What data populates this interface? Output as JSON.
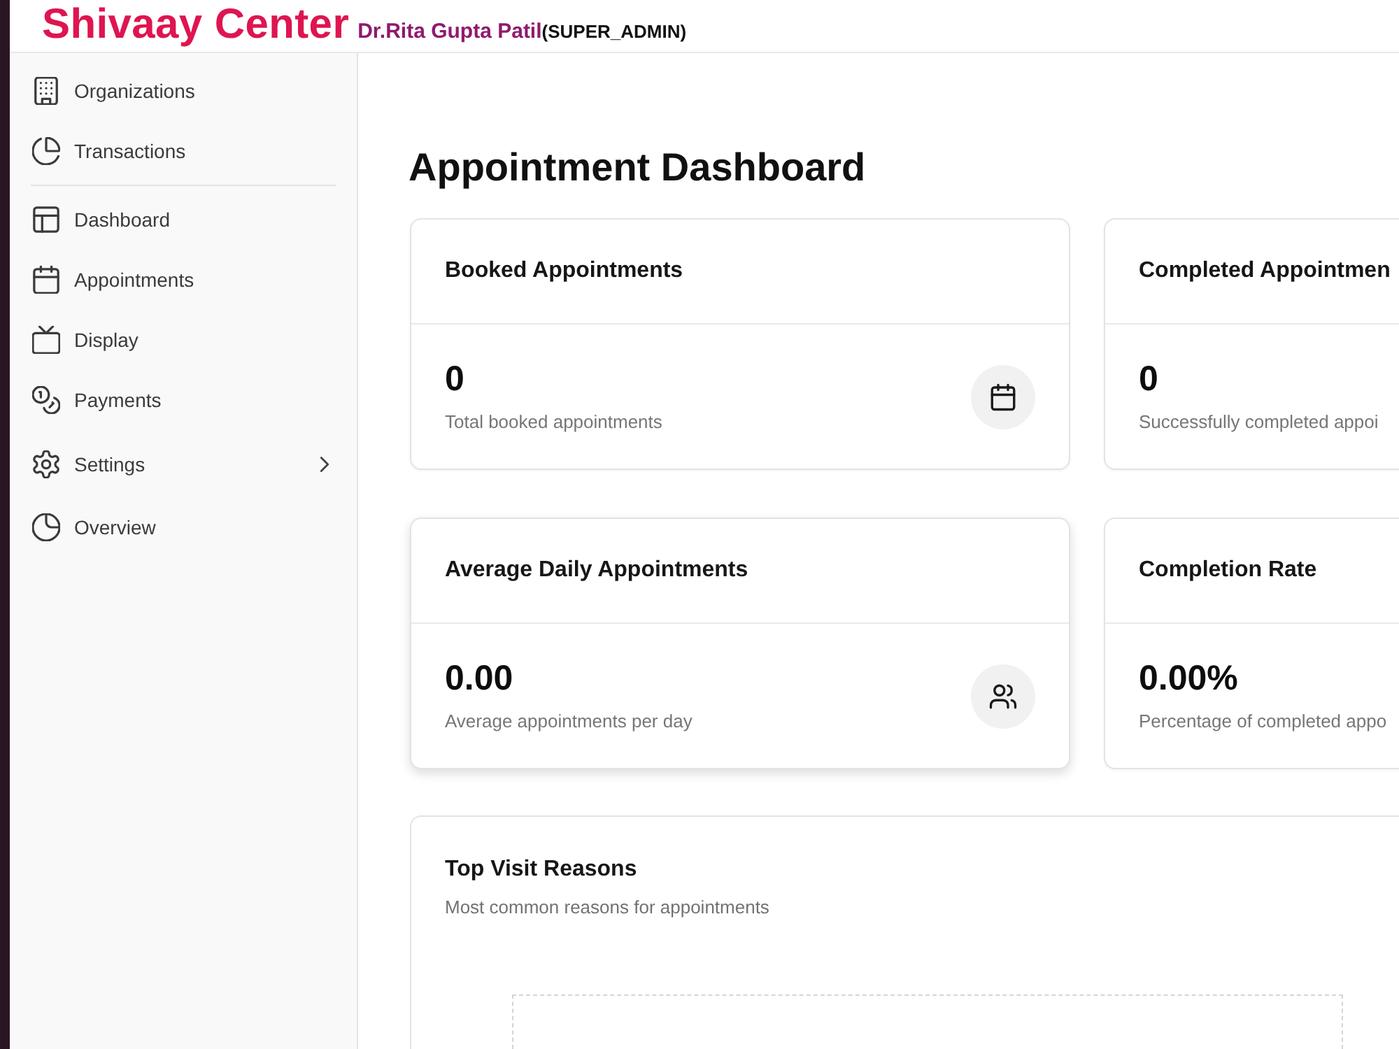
{
  "header": {
    "title": "Shivaay Center",
    "user_name": "Dr.Rita Gupta Patil",
    "role": "(SUPER_ADMIN)"
  },
  "sidebar": {
    "sections": [
      {
        "items": [
          {
            "label": "Organizations",
            "kind": "link"
          },
          {
            "label": "Transactions",
            "kind": "link"
          }
        ]
      },
      {
        "items": [
          {
            "label": "Dashboard",
            "kind": "link"
          },
          {
            "label": "Appointments",
            "kind": "link"
          },
          {
            "label": "Display",
            "kind": "link"
          },
          {
            "label": "Payments",
            "kind": "link"
          },
          {
            "label": "Settings",
            "kind": "submenu"
          },
          {
            "label": "Overview",
            "kind": "link"
          }
        ]
      }
    ]
  },
  "page": {
    "title": "Appointment Dashboard"
  },
  "stats": [
    {
      "title": "Booked Appointments",
      "value": "0",
      "caption": "Total booked appointments",
      "hovered": false
    },
    {
      "title": "Completed Appointmen",
      "value": "0",
      "caption": "Successfully completed appoi",
      "hovered": false
    },
    {
      "title": "Average Daily Appointments",
      "value": "0.00",
      "caption": "Average appointments per day",
      "hovered": true
    },
    {
      "title": "Completion Rate",
      "value": "0.00%",
      "caption": "Percentage of completed appo",
      "hovered": false
    }
  ],
  "reasons_card": {
    "title": "Top Visit Reasons",
    "subtitle": "Most common reasons for appointments"
  }
}
